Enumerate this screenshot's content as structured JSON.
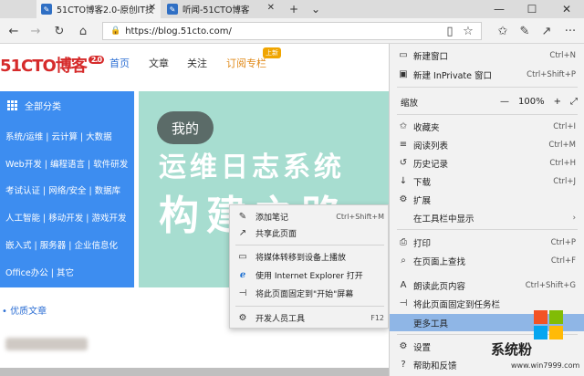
{
  "tabs": [
    {
      "label": "51CTO博客2.0-原创IT技",
      "active": true,
      "icon": "page-icon"
    },
    {
      "label": "听闻-51CTO博客",
      "active": false,
      "icon": "page-icon"
    }
  ],
  "tabbar": {
    "new_tab": "+",
    "tab_list": "⌄",
    "minimize": "—",
    "maximize": "☐",
    "close": "✕"
  },
  "nav": {
    "url": "https://blog.51cto.com/",
    "buttons": {
      "back": "←",
      "forward": "→",
      "refresh": "↻",
      "home": "⌂",
      "read": "▯",
      "favorite": "☆",
      "favorites_hub": "✩",
      "notes": "✎",
      "share": "↗",
      "more": "···"
    }
  },
  "page": {
    "logo": "51CTO博客",
    "logo_badge": "2.0",
    "topnav": [
      "首页",
      "文章",
      "关注",
      "订阅专栏"
    ],
    "new_badge": "上新",
    "category_header": "全部分类",
    "categories": [
      "系统/运维 | 云计算 | 大数据",
      "Web开发 | 编程语言 | 软件研发",
      "考试认证 | 网络/安全 | 数据库",
      "人工智能 | 移动开发 | 游戏开发",
      "嵌入式 | 服务器 | 企业信息化",
      "Office办公 | 其它"
    ],
    "banner_bubble": "我的",
    "banner_line1": "运维日志系统",
    "banner_line2": "构建之路",
    "quality_label": "• 优质文章"
  },
  "context_menu": [
    {
      "icon": "✎",
      "label": "添加笔记",
      "shortcut": "Ctrl+Shift+M"
    },
    {
      "icon": "↗",
      "label": "共享此页面",
      "shortcut": ""
    },
    {
      "icon": "▭",
      "label": "将媒体转移到设备上播放",
      "shortcut": ""
    },
    {
      "icon": "ℯ",
      "label": "使用 Internet Explorer 打开",
      "shortcut": ""
    },
    {
      "icon": "⊣",
      "label": "将此页面固定到\"开始\"屏幕",
      "shortcut": ""
    },
    {
      "icon": "⚙",
      "label": "开发人员工具",
      "shortcut": "F12"
    }
  ],
  "menu": {
    "items": [
      {
        "icon": "▭",
        "label": "新建窗口",
        "shortcut": "Ctrl+N"
      },
      {
        "icon": "▣",
        "label": "新建 InPrivate 窗口",
        "shortcut": "Ctrl+Shift+P"
      },
      {
        "icon": "",
        "label": "缩放",
        "shortcut": ""
      },
      {
        "icon": "✩",
        "label": "收藏夹",
        "shortcut": "Ctrl+I"
      },
      {
        "icon": "≡",
        "label": "阅读列表",
        "shortcut": "Ctrl+M"
      },
      {
        "icon": "↺",
        "label": "历史记录",
        "shortcut": "Ctrl+H"
      },
      {
        "icon": "↓",
        "label": "下载",
        "shortcut": "Ctrl+J"
      },
      {
        "icon": "⚙",
        "label": "扩展",
        "shortcut": ""
      },
      {
        "icon": "",
        "label": "在工具栏中显示",
        "shortcut": "›"
      },
      {
        "icon": "⎙",
        "label": "打印",
        "shortcut": "Ctrl+P"
      },
      {
        "icon": "⌕",
        "label": "在页面上查找",
        "shortcut": "Ctrl+F"
      },
      {
        "icon": "A",
        "label": "朗读此页内容",
        "shortcut": "Ctrl+Shift+G"
      },
      {
        "icon": "⊣",
        "label": "将此页面固定到任务栏",
        "shortcut": ""
      },
      {
        "icon": "",
        "label": "更多工具",
        "shortcut": ""
      },
      {
        "icon": "⚙",
        "label": "设置",
        "shortcut": ""
      },
      {
        "icon": "?",
        "label": "帮助和反馈",
        "shortcut": ""
      }
    ],
    "zoom_minus": "—",
    "zoom_value": "100%",
    "zoom_plus": "+",
    "zoom_fullscreen": "⤢"
  },
  "watermark": {
    "text": "系统粉",
    "url": "www.win7999.com"
  },
  "colors": {
    "accent": "#3d8df0",
    "highlight": "#8fb6e6",
    "logo_red": "#d62b2b",
    "banner": "#a7ddd0"
  }
}
